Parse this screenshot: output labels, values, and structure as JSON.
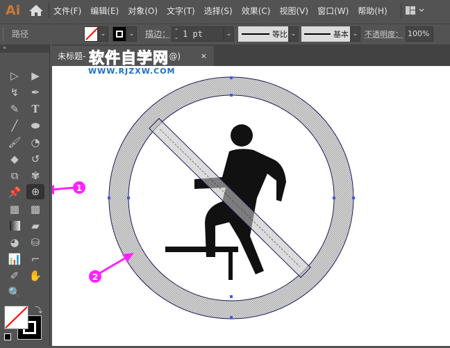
{
  "app": {
    "logo": "Ai"
  },
  "menu": [
    "文件(F)",
    "编辑(E)",
    "对象(O)",
    "文字(T)",
    "选择(S)",
    "效果(C)",
    "视图(V)",
    "窗口(W)",
    "帮助(H)"
  ],
  "control": {
    "object_type": "路径",
    "stroke_label": "描边：",
    "stroke_weight": "1 pt",
    "profile_label": "等比",
    "brush_label": "基本",
    "opacity_label": "不透明度：",
    "opacity_value": "100%"
  },
  "tab": {
    "title": "未标题-",
    "suffix": "@)",
    "close": "×"
  },
  "watermark": {
    "title": "软件自学网",
    "url": "WWW.RJZXW.COM"
  },
  "annotations": [
    "1",
    "2"
  ],
  "colors": {
    "accent": "#ff22ff",
    "watermark": "#1a6fc4",
    "selection": "#3b5bdb"
  }
}
